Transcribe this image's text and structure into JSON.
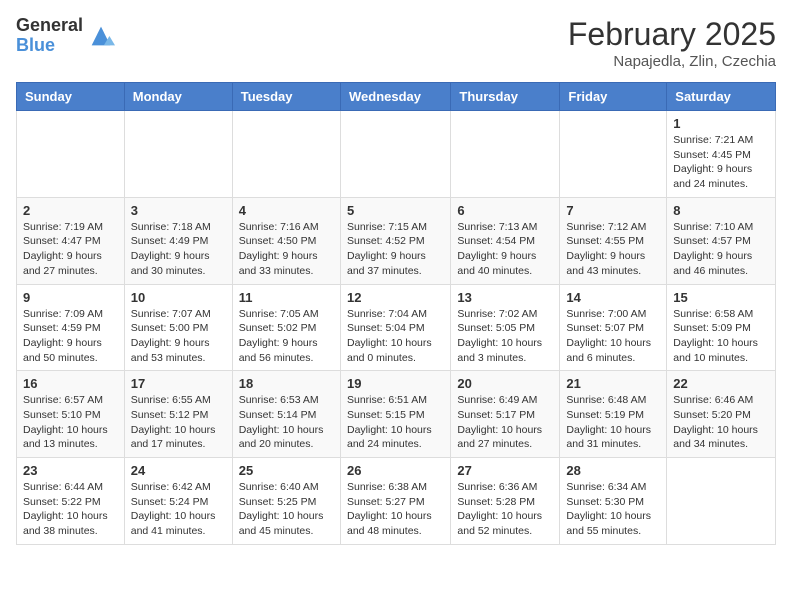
{
  "header": {
    "logo_general": "General",
    "logo_blue": "Blue",
    "month_title": "February 2025",
    "location": "Napajedla, Zlin, Czechia"
  },
  "days_of_week": [
    "Sunday",
    "Monday",
    "Tuesday",
    "Wednesday",
    "Thursday",
    "Friday",
    "Saturday"
  ],
  "weeks": [
    [
      {
        "day": "",
        "info": ""
      },
      {
        "day": "",
        "info": ""
      },
      {
        "day": "",
        "info": ""
      },
      {
        "day": "",
        "info": ""
      },
      {
        "day": "",
        "info": ""
      },
      {
        "day": "",
        "info": ""
      },
      {
        "day": "1",
        "info": "Sunrise: 7:21 AM\nSunset: 4:45 PM\nDaylight: 9 hours and 24 minutes."
      }
    ],
    [
      {
        "day": "2",
        "info": "Sunrise: 7:19 AM\nSunset: 4:47 PM\nDaylight: 9 hours and 27 minutes."
      },
      {
        "day": "3",
        "info": "Sunrise: 7:18 AM\nSunset: 4:49 PM\nDaylight: 9 hours and 30 minutes."
      },
      {
        "day": "4",
        "info": "Sunrise: 7:16 AM\nSunset: 4:50 PM\nDaylight: 9 hours and 33 minutes."
      },
      {
        "day": "5",
        "info": "Sunrise: 7:15 AM\nSunset: 4:52 PM\nDaylight: 9 hours and 37 minutes."
      },
      {
        "day": "6",
        "info": "Sunrise: 7:13 AM\nSunset: 4:54 PM\nDaylight: 9 hours and 40 minutes."
      },
      {
        "day": "7",
        "info": "Sunrise: 7:12 AM\nSunset: 4:55 PM\nDaylight: 9 hours and 43 minutes."
      },
      {
        "day": "8",
        "info": "Sunrise: 7:10 AM\nSunset: 4:57 PM\nDaylight: 9 hours and 46 minutes."
      }
    ],
    [
      {
        "day": "9",
        "info": "Sunrise: 7:09 AM\nSunset: 4:59 PM\nDaylight: 9 hours and 50 minutes."
      },
      {
        "day": "10",
        "info": "Sunrise: 7:07 AM\nSunset: 5:00 PM\nDaylight: 9 hours and 53 minutes."
      },
      {
        "day": "11",
        "info": "Sunrise: 7:05 AM\nSunset: 5:02 PM\nDaylight: 9 hours and 56 minutes."
      },
      {
        "day": "12",
        "info": "Sunrise: 7:04 AM\nSunset: 5:04 PM\nDaylight: 10 hours and 0 minutes."
      },
      {
        "day": "13",
        "info": "Sunrise: 7:02 AM\nSunset: 5:05 PM\nDaylight: 10 hours and 3 minutes."
      },
      {
        "day": "14",
        "info": "Sunrise: 7:00 AM\nSunset: 5:07 PM\nDaylight: 10 hours and 6 minutes."
      },
      {
        "day": "15",
        "info": "Sunrise: 6:58 AM\nSunset: 5:09 PM\nDaylight: 10 hours and 10 minutes."
      }
    ],
    [
      {
        "day": "16",
        "info": "Sunrise: 6:57 AM\nSunset: 5:10 PM\nDaylight: 10 hours and 13 minutes."
      },
      {
        "day": "17",
        "info": "Sunrise: 6:55 AM\nSunset: 5:12 PM\nDaylight: 10 hours and 17 minutes."
      },
      {
        "day": "18",
        "info": "Sunrise: 6:53 AM\nSunset: 5:14 PM\nDaylight: 10 hours and 20 minutes."
      },
      {
        "day": "19",
        "info": "Sunrise: 6:51 AM\nSunset: 5:15 PM\nDaylight: 10 hours and 24 minutes."
      },
      {
        "day": "20",
        "info": "Sunrise: 6:49 AM\nSunset: 5:17 PM\nDaylight: 10 hours and 27 minutes."
      },
      {
        "day": "21",
        "info": "Sunrise: 6:48 AM\nSunset: 5:19 PM\nDaylight: 10 hours and 31 minutes."
      },
      {
        "day": "22",
        "info": "Sunrise: 6:46 AM\nSunset: 5:20 PM\nDaylight: 10 hours and 34 minutes."
      }
    ],
    [
      {
        "day": "23",
        "info": "Sunrise: 6:44 AM\nSunset: 5:22 PM\nDaylight: 10 hours and 38 minutes."
      },
      {
        "day": "24",
        "info": "Sunrise: 6:42 AM\nSunset: 5:24 PM\nDaylight: 10 hours and 41 minutes."
      },
      {
        "day": "25",
        "info": "Sunrise: 6:40 AM\nSunset: 5:25 PM\nDaylight: 10 hours and 45 minutes."
      },
      {
        "day": "26",
        "info": "Sunrise: 6:38 AM\nSunset: 5:27 PM\nDaylight: 10 hours and 48 minutes."
      },
      {
        "day": "27",
        "info": "Sunrise: 6:36 AM\nSunset: 5:28 PM\nDaylight: 10 hours and 52 minutes."
      },
      {
        "day": "28",
        "info": "Sunrise: 6:34 AM\nSunset: 5:30 PM\nDaylight: 10 hours and 55 minutes."
      },
      {
        "day": "",
        "info": ""
      }
    ]
  ]
}
